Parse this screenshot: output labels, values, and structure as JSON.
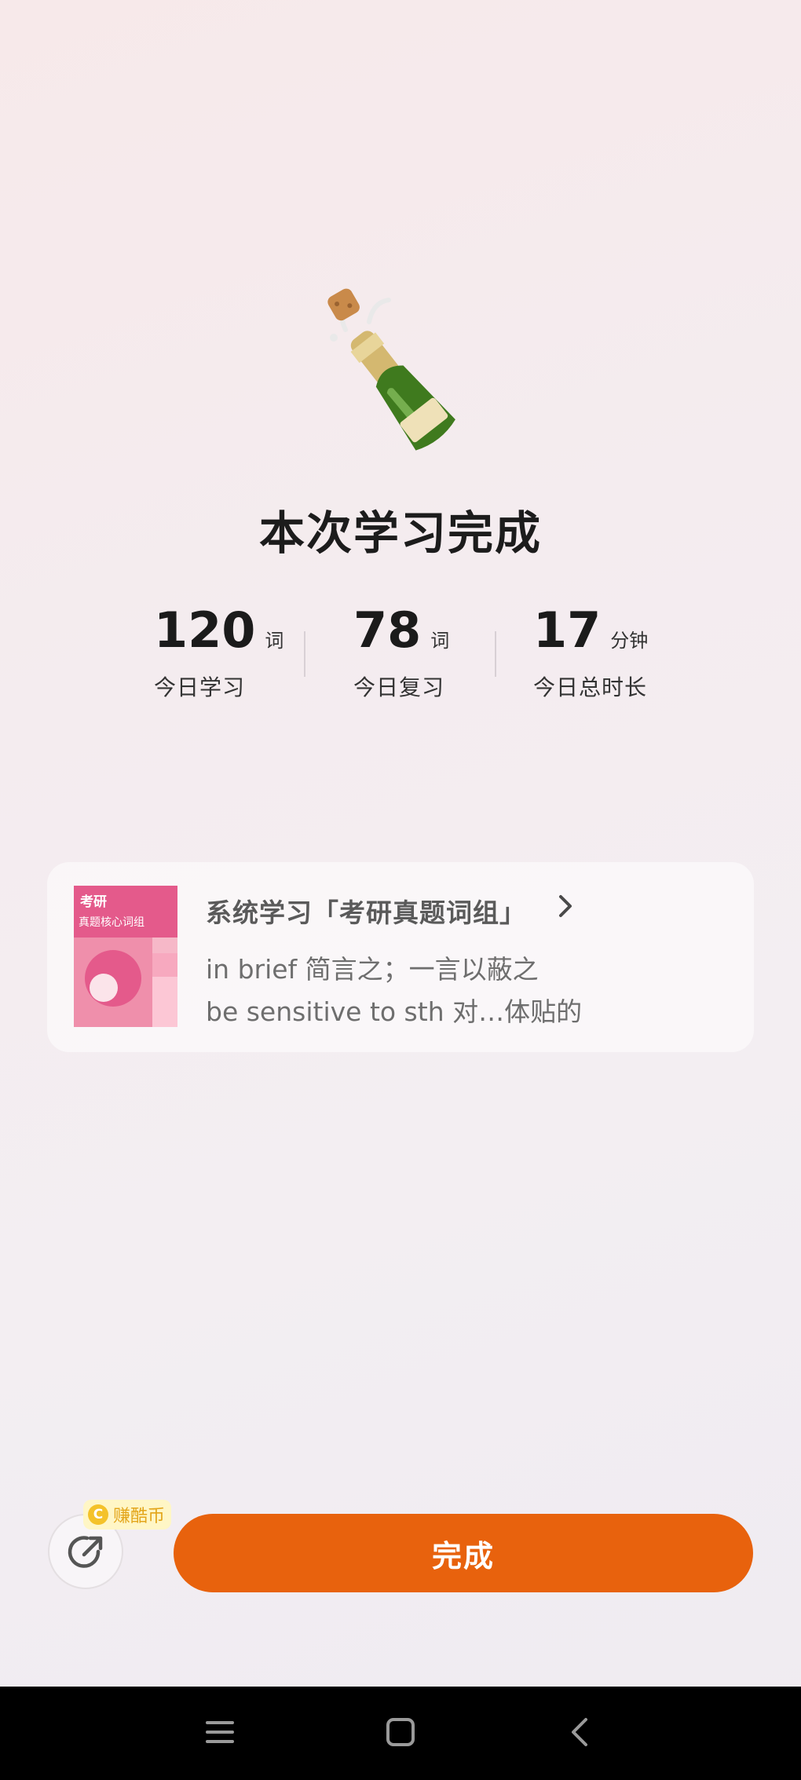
{
  "completion": {
    "title": "本次学习完成"
  },
  "stats": [
    {
      "value": "120",
      "unit": "词",
      "label": "今日学习"
    },
    {
      "value": "78",
      "unit": "词",
      "label": "今日复习"
    },
    {
      "value": "17",
      "unit": "分钟",
      "label": "今日总时长"
    }
  ],
  "course_card": {
    "cover_title": "考研",
    "cover_subtitle": "真题核心词组",
    "title": "系统学习「考研真题词组」",
    "lines": [
      "in brief 简言之；一言以蔽之",
      "be sensitive to sth 对…体贴的"
    ]
  },
  "actions": {
    "coin_icon": "C",
    "coin_badge": "赚酷币",
    "done_label": "完成"
  },
  "colors": {
    "accent": "#e8620d",
    "cover_pink": "#e45a8b",
    "coin": "#f4c22a"
  },
  "icons": {
    "celebration": "champagne-bottle-icon",
    "share": "share-arrow-icon",
    "nav": [
      "menu-icon",
      "home-square-icon",
      "back-chevron-icon"
    ]
  }
}
